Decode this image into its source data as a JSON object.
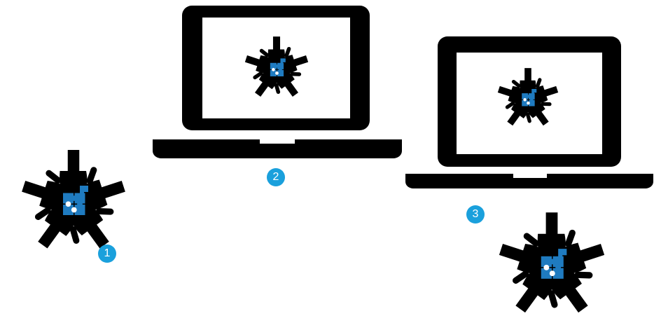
{
  "colors": {
    "ink": "#000000",
    "badge": "#1aa0dc",
    "puzzle": "#1f7bc0",
    "screen": "#ffffff"
  },
  "icons": {
    "hands": "hands-circle-icon",
    "puzzle": "puzzle-piece-icon",
    "laptop": "laptop-icon"
  },
  "steps": [
    {
      "number": "1"
    },
    {
      "number": "2"
    },
    {
      "number": "3"
    }
  ]
}
